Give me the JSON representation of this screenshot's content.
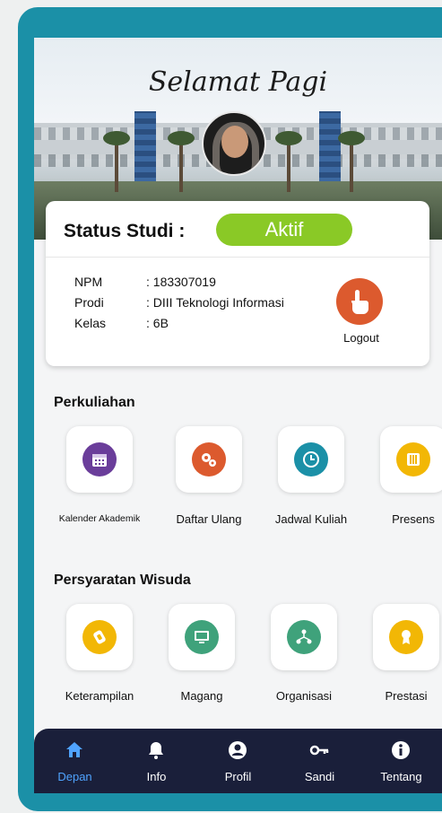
{
  "header": {
    "greeting": "Selamat Pagi"
  },
  "status": {
    "title": "Status Studi :",
    "badge": "Aktif",
    "badge_color": "#8ac926",
    "fields": [
      {
        "label": "NPM",
        "value": ": 183307019"
      },
      {
        "label": "Prodi",
        "value": ": DIII Teknologi Informasi"
      },
      {
        "label": "Kelas",
        "value": ": 6B"
      }
    ],
    "logout_label": "Logout"
  },
  "perkuliahan": {
    "title": "Perkuliahan",
    "items": [
      {
        "label": "Kalender Akademik",
        "icon": "calendar-icon",
        "color": "#6a3d9a"
      },
      {
        "label": "Daftar Ulang",
        "icon": "gears-icon",
        "color": "#dc5a2e"
      },
      {
        "label": "Jadwal Kuliah",
        "icon": "clock-icon",
        "color": "#1b90a7"
      },
      {
        "label": "Presens",
        "icon": "attendance-icon",
        "color": "#f2b705"
      }
    ]
  },
  "wisuda": {
    "title": "Persyaratan Wisuda",
    "items": [
      {
        "label": "Keterampilan",
        "icon": "certificate-icon",
        "color": "#f2b705"
      },
      {
        "label": "Magang",
        "icon": "monitor-icon",
        "color": "#3fa27b"
      },
      {
        "label": "Organisasi",
        "icon": "network-icon",
        "color": "#3fa27b"
      },
      {
        "label": "Prestasi",
        "icon": "award-icon",
        "color": "#f2b705"
      }
    ]
  },
  "nav": {
    "items": [
      {
        "label": "Depan",
        "icon": "home-icon",
        "active": true
      },
      {
        "label": "Info",
        "icon": "bell-icon",
        "active": false
      },
      {
        "label": "Profil",
        "icon": "user-icon",
        "active": false
      },
      {
        "label": "Sandi",
        "icon": "key-icon",
        "active": false
      },
      {
        "label": "Tentang",
        "icon": "info-icon",
        "active": false
      }
    ]
  }
}
